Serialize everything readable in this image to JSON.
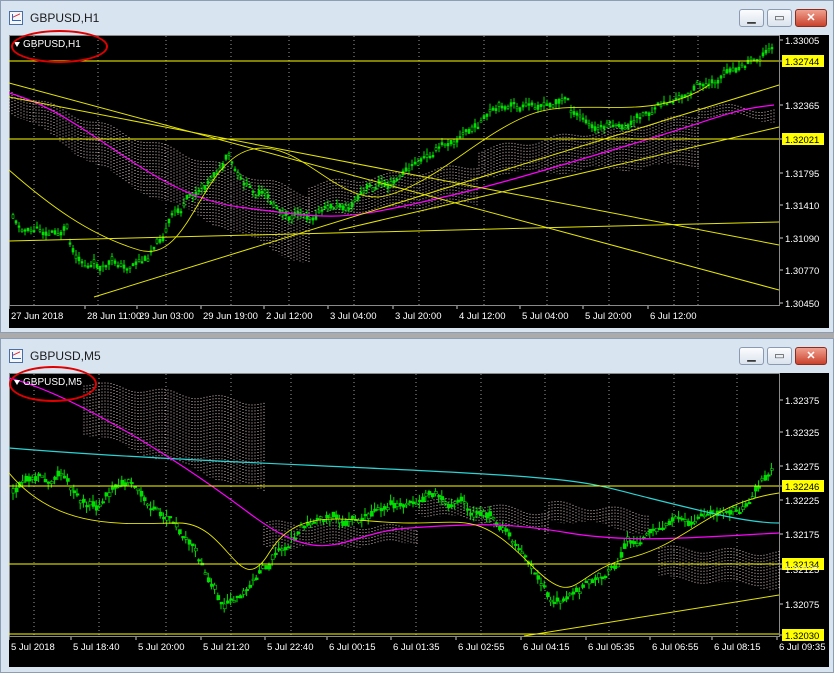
{
  "windows": [
    {
      "id": "h1",
      "title": "GBPUSD,H1",
      "symbol_label": "GBPUSD,H1",
      "buttons": {
        "minimize": "▁",
        "restore": "▭",
        "close": "✕"
      },
      "price_labels": [
        "1.33005",
        "1.32744",
        "1.32365",
        "1.32021",
        "1.31795",
        "1.31410",
        "1.31090",
        "1.30770",
        "1.30450"
      ],
      "highlighted_prices": [
        "1.32744",
        "1.32021"
      ],
      "time_labels": [
        "27 Jun 2018",
        "28 Jun 11:00",
        "29 Jun 03:00",
        "29 Jun 19:00",
        "2 Jul 12:00",
        "3 Jul 04:00",
        "3 Jul 20:00",
        "4 Jul 12:00",
        "5 Jul 04:00",
        "5 Jul 20:00",
        "6 Jul 12:00"
      ]
    },
    {
      "id": "m5",
      "title": "GBPUSD,M5",
      "symbol_label": "GBPUSD,M5",
      "buttons": {
        "minimize": "▁",
        "restore": "▭",
        "close": "✕"
      },
      "price_labels": [
        "1.32375",
        "1.32325",
        "1.32275",
        "1.32246",
        "1.32225",
        "1.32175",
        "1.32134",
        "1.32125",
        "1.32075",
        "1.32030"
      ],
      "highlighted_prices": [
        "1.32246",
        "1.32134",
        "1.32030"
      ],
      "time_labels": [
        "5 Jul 2018",
        "5 Jul 18:40",
        "5 Jul 20:00",
        "5 Jul 21:20",
        "5 Jul 22:40",
        "6 Jul 00:15",
        "6 Jul 01:35",
        "6 Jul 02:55",
        "6 Jul 04:15",
        "6 Jul 05:35",
        "6 Jul 06:55",
        "6 Jul 08:15",
        "6 Jul 09:35"
      ]
    }
  ],
  "colors": {
    "background": "#000000",
    "bull_candle": "#00e000",
    "horizontal_level": "#ffff00",
    "trendline": "#e6e600",
    "ichimoku_cloud": "#ffe4e1",
    "ma_magenta": "#ff00ff",
    "ma_cyan": "#2ad4d4",
    "highlight_label_bg": "#ffff00",
    "annotation_circle": "#e00000"
  }
}
